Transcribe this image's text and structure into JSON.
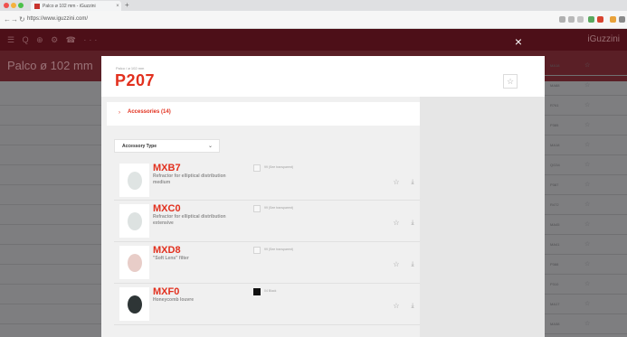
{
  "browser": {
    "tab_title": "Palco ø 102 mm - iGuzzini",
    "tab_close": "×",
    "new_tab": "+",
    "url": "https://www.iguzzini.com/",
    "back": "←",
    "forward": "→",
    "reload": "↻",
    "secure": "🔒"
  },
  "site": {
    "brand": "iGuzzini",
    "nav_icons": "☰ Q ⊕ ⚙ ☎ ···",
    "page_heading": "Palco ø 102 mm",
    "right_rows": [
      {
        "code": "MA18",
        "star": "☆"
      },
      {
        "code": "MA88",
        "star": "☆"
      },
      {
        "code": "R761",
        "star": "☆"
      },
      {
        "code": "P385",
        "star": "☆"
      },
      {
        "code": "MA18",
        "star": "☆"
      },
      {
        "code": "QG34",
        "star": "☆"
      },
      {
        "code": "P387",
        "star": "☆"
      },
      {
        "code": "R472",
        "star": "☆"
      },
      {
        "code": "MA45",
        "star": "☆"
      },
      {
        "code": "MA41",
        "star": "☆"
      },
      {
        "code": "P388",
        "star": "☆"
      },
      {
        "code": "P310",
        "star": "☆"
      },
      {
        "code": "MA17",
        "star": "☆"
      },
      {
        "code": "MA38",
        "star": "☆"
      }
    ]
  },
  "modal": {
    "close": "×",
    "breadcrumb": "Palco / ø 102 mm",
    "title": "P207",
    "favorite": "☆",
    "accessories_label": "Accessories (14)",
    "accessories_chevron": "›",
    "filter_label": "Accessory Type",
    "filter_chevron": "⌄",
    "items": [
      {
        "code": "MXB7",
        "desc": "Refractor for elliptical distribution medium",
        "swatch_label": "99 (See transparent)",
        "swatch_color": "#f7f7f7",
        "disc_color": "#dfe4e3",
        "star": "☆",
        "download": "⤓"
      },
      {
        "code": "MXC0",
        "desc": "Refractor for elliptical distribution extensive",
        "swatch_label": "99 (See transparent)",
        "swatch_color": "#f7f7f7",
        "disc_color": "#dde2e1",
        "star": "☆",
        "download": "⤓"
      },
      {
        "code": "MXD8",
        "desc": "\"Soft Lens\" filter",
        "swatch_label": "99 (See transparent)",
        "swatch_color": "#f7f7f7",
        "disc_color": "#e8cdc8",
        "star": "☆",
        "download": "⤓"
      },
      {
        "code": "MXF0",
        "desc": "Honeycomb louvre",
        "swatch_label": "04 Black",
        "swatch_color": "#111111",
        "disc_color": "#2e3536",
        "star": "☆",
        "download": "⤓"
      }
    ]
  }
}
